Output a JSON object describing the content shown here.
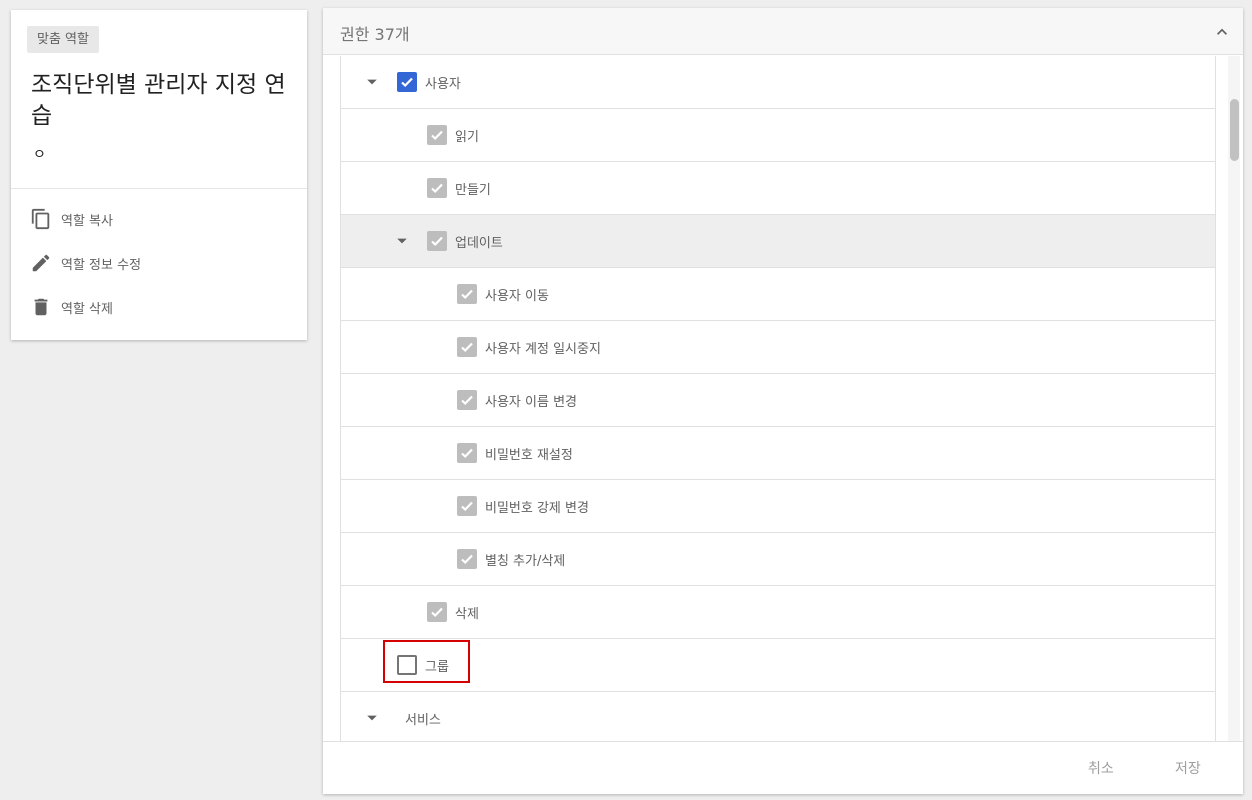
{
  "role_card": {
    "chip": "맞춤 역할",
    "title": "조직단위별 관리자 지정 연습",
    "description": "ㅇ",
    "actions": {
      "copy": "역할 복사",
      "edit": "역할 정보 수정",
      "delete": "역할 삭제"
    }
  },
  "permissions": {
    "header": "권한 37개",
    "rows": {
      "users": "사용자",
      "read": "읽기",
      "create": "만들기",
      "update": "업데이트",
      "move_user": "사용자 이동",
      "suspend_user": "사용자 계정 일시중지",
      "rename_user": "사용자 이름 변경",
      "reset_password": "비밀번호 재설정",
      "force_password_change": "비밀번호 강제 변경",
      "alias": "별칭 추가/삭제",
      "delete": "삭제",
      "groups": "그룹",
      "services": "서비스"
    }
  },
  "footer": {
    "cancel": "취소",
    "save": "저장"
  },
  "colors": {
    "checked_primary": "#3367d6",
    "checked_inherited": "#bdbdbd",
    "highlight_border": "#d50000"
  }
}
